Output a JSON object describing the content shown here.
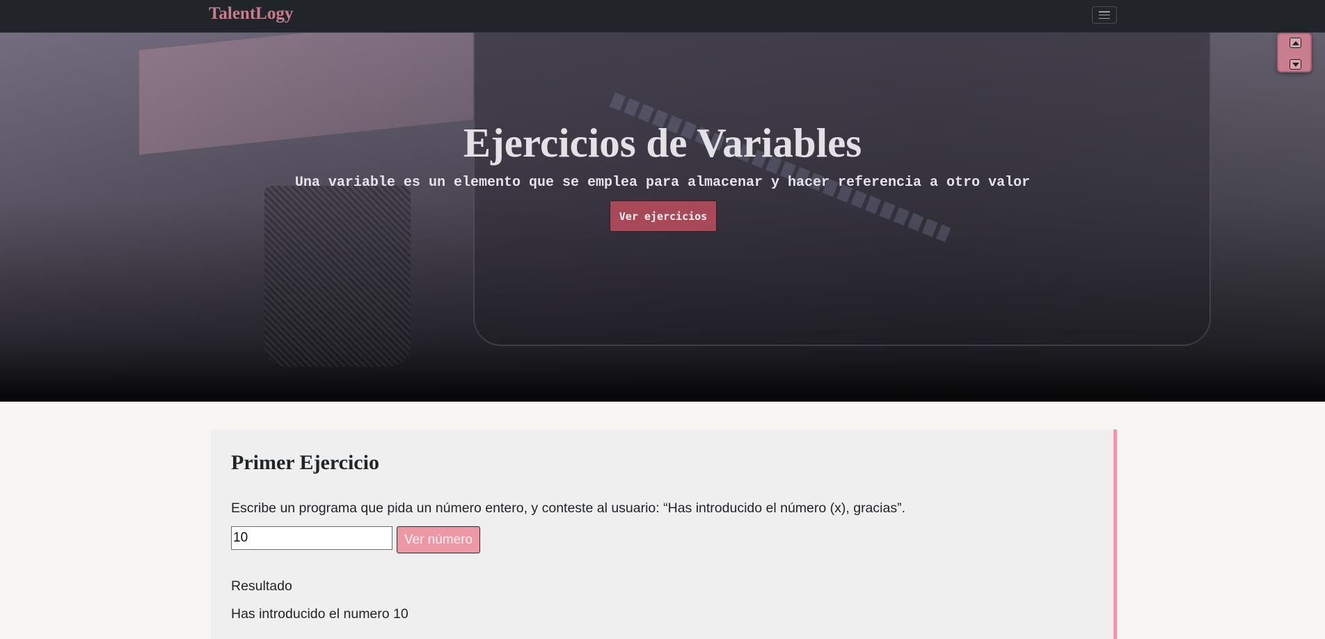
{
  "navbar": {
    "brand": "TalentLogy",
    "toggler_icon": "hamburger-icon"
  },
  "hero": {
    "title": "Ejercicios de Variables",
    "subtitle": "Una variable es un elemento que se emplea para almacenar y hacer referencia a otro valor",
    "button_label": "Ver ejercicios"
  },
  "scroll_widget": {
    "up_icon": "arrow-up-icon",
    "down_icon": "arrow-down-icon"
  },
  "exercise": {
    "title": "Primer Ejercicio",
    "description": "Escribe un programa que pida un número entero, y conteste al usuario: “Has introducido el número (x), gracias”.",
    "input_value": "10",
    "button_label": "Ver número",
    "result_label": "Resultado",
    "result_text": "Has introducido el numero 10"
  },
  "colors": {
    "navbar_bg": "#212429",
    "brand": "#c97e90",
    "hero_button": "#a8495a",
    "accent_pink": "#ec98a6",
    "page_bg": "#f7f6f2",
    "card_bg": "#efefef"
  }
}
